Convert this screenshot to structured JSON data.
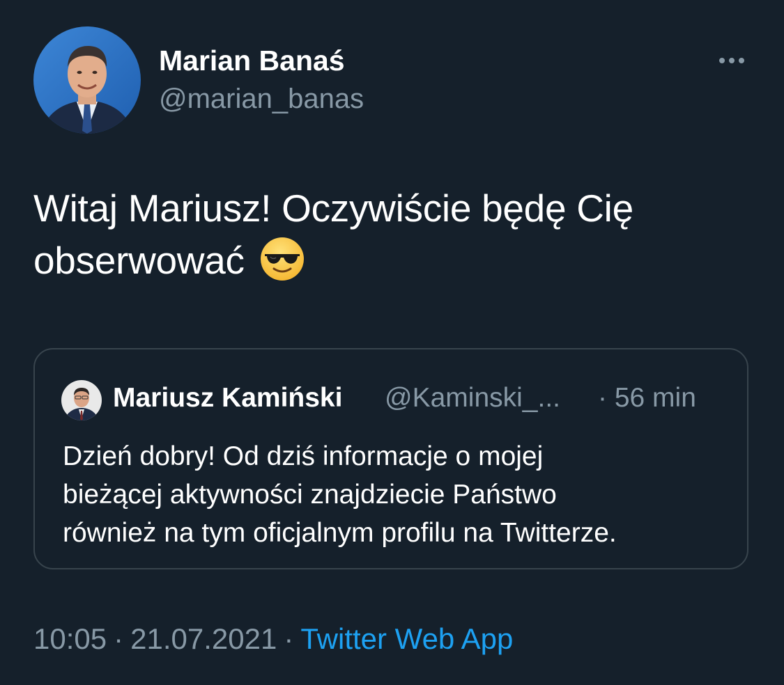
{
  "tweet": {
    "author": {
      "name": "Marian Banaś",
      "handle": "@marian_banas"
    },
    "more_icon": "more-horizontal-icon",
    "text_line_1": "Witaj Mariusz! Oczywiście będę Cię",
    "text_line_2": "obserwować",
    "emoji": "smiling-face-with-sunglasses-emoji",
    "quote": {
      "author_name": "Mariusz Kamiński",
      "author_handle": "@Kaminski_...",
      "time": "· 56 min",
      "lines": [
        "Dzień dobry! Od dziś informacje o mojej",
        "bieżącej aktywności znajdziecie Państwo",
        "również na tym oficjalnym profilu na Twitterze."
      ]
    },
    "meta": {
      "time": "10:05",
      "separator": "·",
      "date": "21.07.2021",
      "source": "Twitter Web App"
    }
  },
  "colors": {
    "background": "#15202b",
    "text_primary": "#ffffff",
    "text_secondary": "#8899a6",
    "accent": "#1da1f2",
    "border": "#38444d"
  }
}
